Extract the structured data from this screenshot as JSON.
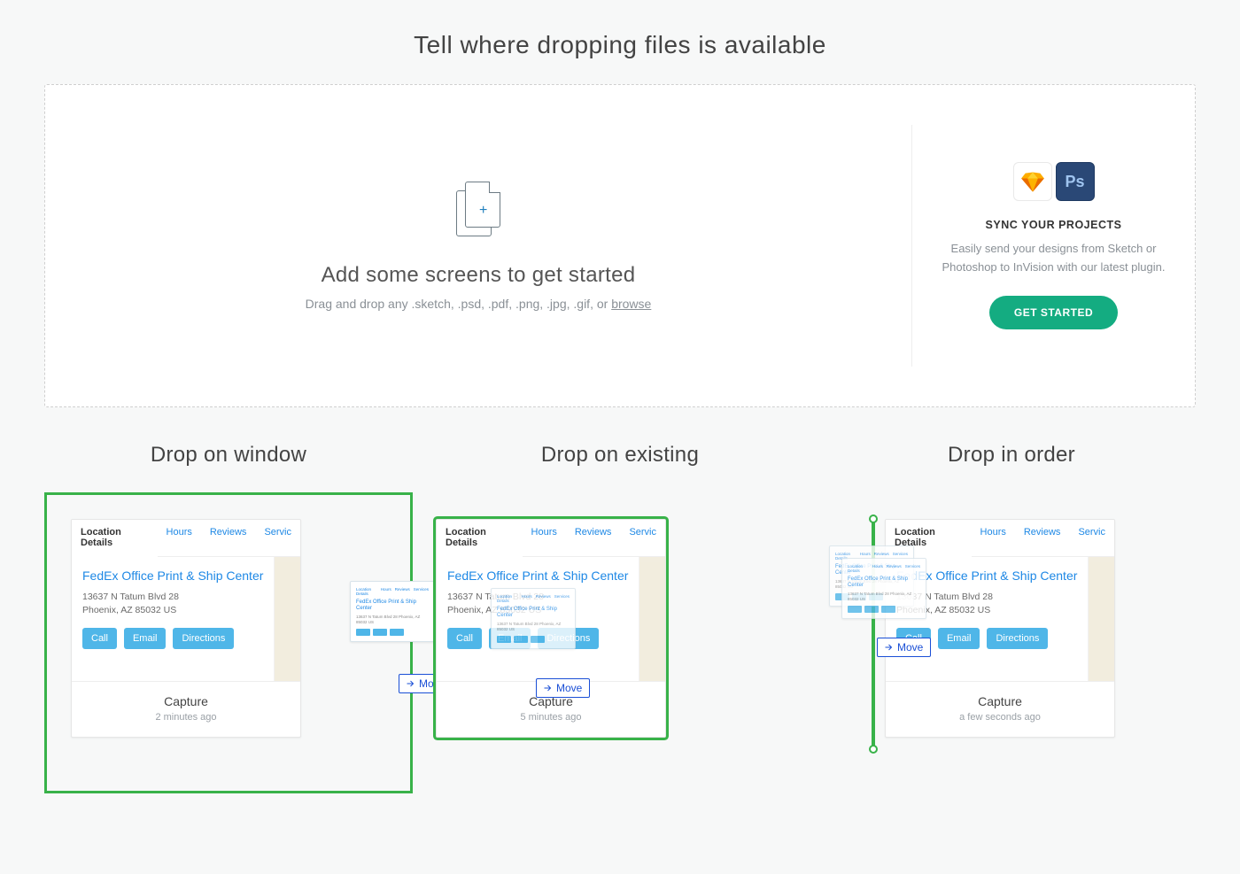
{
  "page_title": "Tell where dropping files is available",
  "dropzone": {
    "title": "Add some screens to get started",
    "subtitle_pre": "Drag and drop any .sketch, .psd, .pdf, .png, .jpg, .gif, or ",
    "browse": "browse"
  },
  "sync": {
    "title": "SYNC YOUR PROJECTS",
    "desc": "Easily send your designs from Sketch or Photoshop to InVision with our latest plugin.",
    "cta": "GET STARTED",
    "ps_label": "Ps"
  },
  "columns": [
    {
      "title": "Drop on window"
    },
    {
      "title": "Drop on existing"
    },
    {
      "title": "Drop in order"
    }
  ],
  "card": {
    "tabs": {
      "active": "Location Details",
      "t1": "Hours",
      "t2": "Reviews",
      "t3": "Servic"
    },
    "heading": "FedEx Office Print & Ship Center",
    "addr1": "13637 N Tatum Blvd 28",
    "addr2": "Phoenix, AZ 85032 US",
    "btn_call": "Call",
    "btn_email": "Email",
    "btn_dir": "Directions",
    "footer_title": "Capture",
    "footer_sub_1": "2 minutes ago",
    "footer_sub_2": "5 minutes ago",
    "footer_sub_3": "a few seconds ago"
  },
  "thumb": {
    "h": "FedEx Office Print & Ship Center",
    "addr": "13637 N Tatum Blvd 28\nPhoenix, AZ 85032 US",
    "tt0": "Location Details",
    "tt1": "Hours",
    "tt2": "Reviews",
    "tt3": "Services"
  },
  "move_label": "Move"
}
